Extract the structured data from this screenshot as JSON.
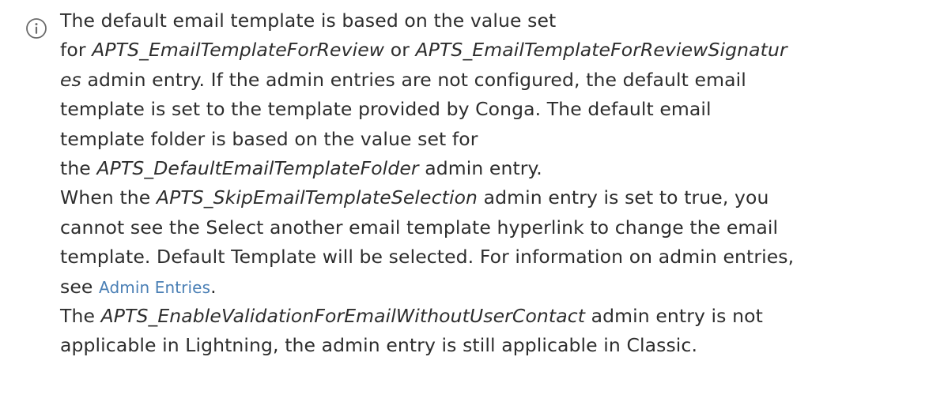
{
  "note": {
    "icon": "info-icon",
    "colors": {
      "text": "#2d2d2d",
      "link": "#4a7fb5",
      "icon": "#6b6b6b"
    },
    "p1": {
      "a": "The default email template is based on the value set",
      "b": "for ",
      "c": "APTS_EmailTemplateForReview",
      "d": " or ",
      "e": "APTS_EmailTemplateForReviewSignatur",
      "f": "es",
      "g": " admin entry. If the admin entries are not configured, the default email",
      "h": "template is set to the template provided by Conga. The default email",
      "i": "template folder is based on the value set for",
      "j": "the ",
      "k": "APTS_DefaultEmailTemplateFolder",
      "l": " admin entry."
    },
    "p2": {
      "a": "When the ",
      "b": "APTS_SkipEmailTemplateSelection",
      "c": " admin entry is set to true, you",
      "d": "cannot see the Select another email template hyperlink to change the email",
      "e": "template. Default Template will be selected. For information on admin entries,",
      "f": "see ",
      "g": "Admin Entries",
      "h": "."
    },
    "p3": {
      "a": "The ",
      "b": "APTS_EnableValidationForEmailWithoutUserContact",
      "c": " admin entry is not",
      "d": "applicable in Lightning, the admin entry is still applicable in Classic."
    }
  }
}
